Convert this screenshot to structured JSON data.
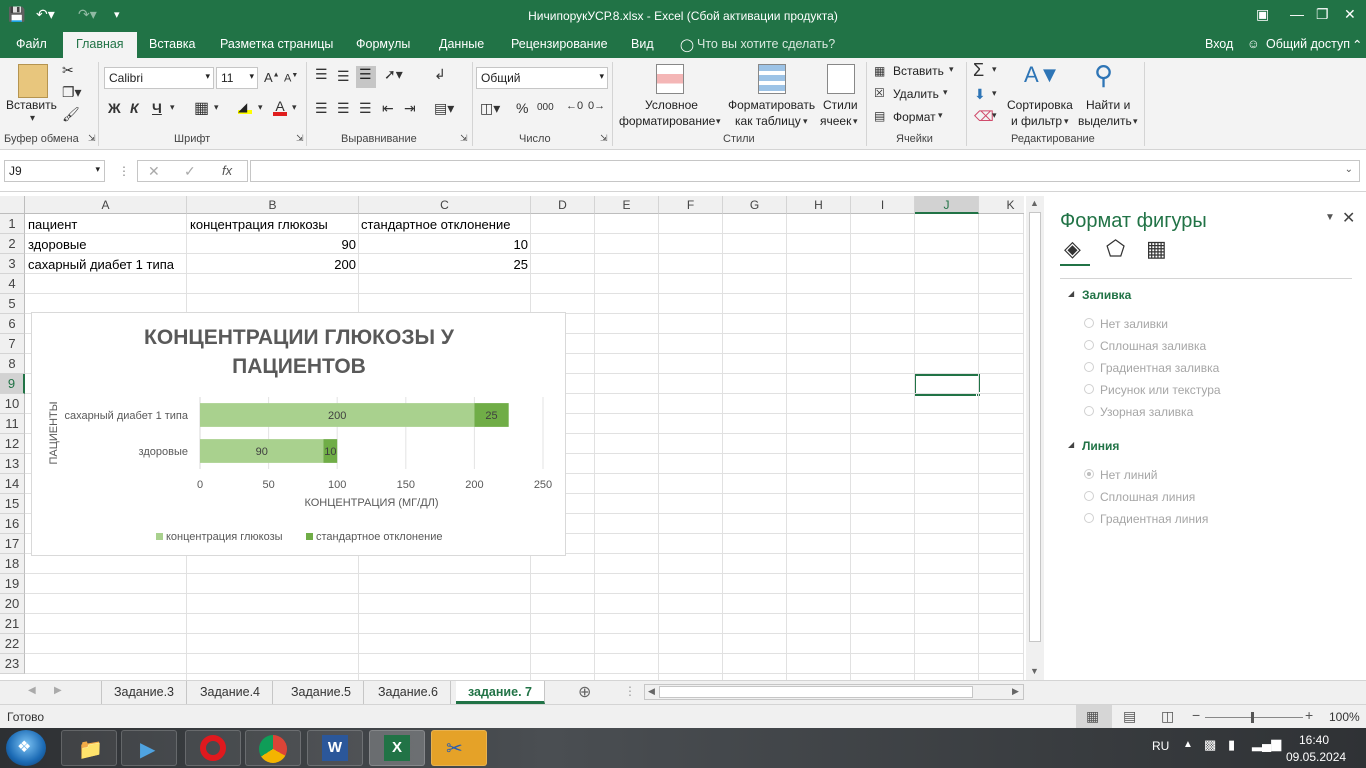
{
  "window": {
    "title": "НичипорукУСР.8.xlsx - Excel (Сбой активации продукта)"
  },
  "ribbon_tabs": [
    "Файл",
    "Главная",
    "Вставка",
    "Разметка страницы",
    "Формулы",
    "Данные",
    "Рецензирование",
    "Вид"
  ],
  "tell_me": "Что вы хотите сделать?",
  "account": {
    "signin": "Вход",
    "share": "Общий доступ"
  },
  "ribbon": {
    "clipboard": {
      "paste": "Вставить",
      "group": "Буфер обмена"
    },
    "font": {
      "name": "Calibri",
      "size": "11",
      "bold": "Ж",
      "italic": "К",
      "underline": "Ч",
      "group": "Шрифт"
    },
    "alignment": {
      "group": "Выравнивание"
    },
    "number": {
      "format": "Общий",
      "percent": "%",
      "thousands": "000",
      "group": "Число"
    },
    "styles": {
      "cond1": "Условное",
      "cond2": "форматирование",
      "table1": "Форматировать",
      "table2": "как таблицу",
      "cell1": "Стили",
      "cell2": "ячеек",
      "group": "Стили"
    },
    "cells": {
      "insert": "Вставить",
      "delete": "Удалить",
      "format": "Формат",
      "group": "Ячейки"
    },
    "editing": {
      "sort1": "Сортировка",
      "sort2": "и фильтр",
      "find1": "Найти и",
      "find2": "выделить",
      "group": "Редактирование"
    }
  },
  "formula_bar": {
    "name_box": "J9",
    "fx": "fx",
    "formula": ""
  },
  "columns": [
    "A",
    "B",
    "C",
    "D",
    "E",
    "F",
    "G",
    "H",
    "I",
    "J",
    "K"
  ],
  "rows": [
    "1",
    "2",
    "3",
    "4",
    "5",
    "6",
    "7",
    "8",
    "9",
    "10",
    "11",
    "12",
    "13",
    "14",
    "15",
    "16",
    "17",
    "18",
    "19",
    "20",
    "21",
    "22",
    "23"
  ],
  "cells": {
    "A1": "пациент",
    "B1": "концентрация глюкозы",
    "C1": "стандартное отклонение",
    "A2": "здоровые",
    "B2": "90",
    "C2": "10",
    "A3": "сахарный диабет 1 типа",
    "B3": "200",
    "C3": "25"
  },
  "chart_data": {
    "type": "bar",
    "stacked": true,
    "orientation": "horizontal",
    "title_line1": "КОНЦЕНТРАЦИИ ГЛЮКОЗЫ У",
    "title_line2": "ПАЦИЕНТОВ",
    "xlabel": "КОНЦЕНТРАЦИЯ (МГ/ДЛ)",
    "ylabel": "ПАЦИЕНТЫ",
    "categories": [
      "здоровые",
      "сахарный диабет 1 типа"
    ],
    "series": [
      {
        "name": "концентрация глюкозы",
        "values": [
          90,
          200
        ],
        "color": "#a9d18e"
      },
      {
        "name": "стандартное отклонение",
        "values": [
          10,
          25
        ],
        "color": "#70ad47"
      }
    ],
    "xlim": [
      0,
      250
    ],
    "xticks": [
      "0",
      "50",
      "100",
      "150",
      "200",
      "250"
    ],
    "legend": "bottom",
    "grid": true
  },
  "format_pane": {
    "title": "Формат фигуры",
    "fill_header": "Заливка",
    "fill_options": [
      "Нет заливки",
      "Сплошная заливка",
      "Градиентная заливка",
      "Рисунок или текстура",
      "Узорная заливка"
    ],
    "line_header": "Линия",
    "line_options": [
      "Нет линий",
      "Сплошная линия",
      "Градиентная линия"
    ]
  },
  "sheets": [
    "Задание.3",
    "Задание.4",
    "Задание.5",
    "Задание.6",
    "задание. 7"
  ],
  "active_sheet": "задание. 7",
  "status": {
    "ready": "Готово",
    "zoom": "100%"
  },
  "taskbar": {
    "lang": "RU",
    "time": "16:40",
    "date": "09.05.2024"
  },
  "colors": {
    "excel_green": "#217346",
    "bar_light": "#a9d18e",
    "bar_dark": "#70ad47"
  }
}
